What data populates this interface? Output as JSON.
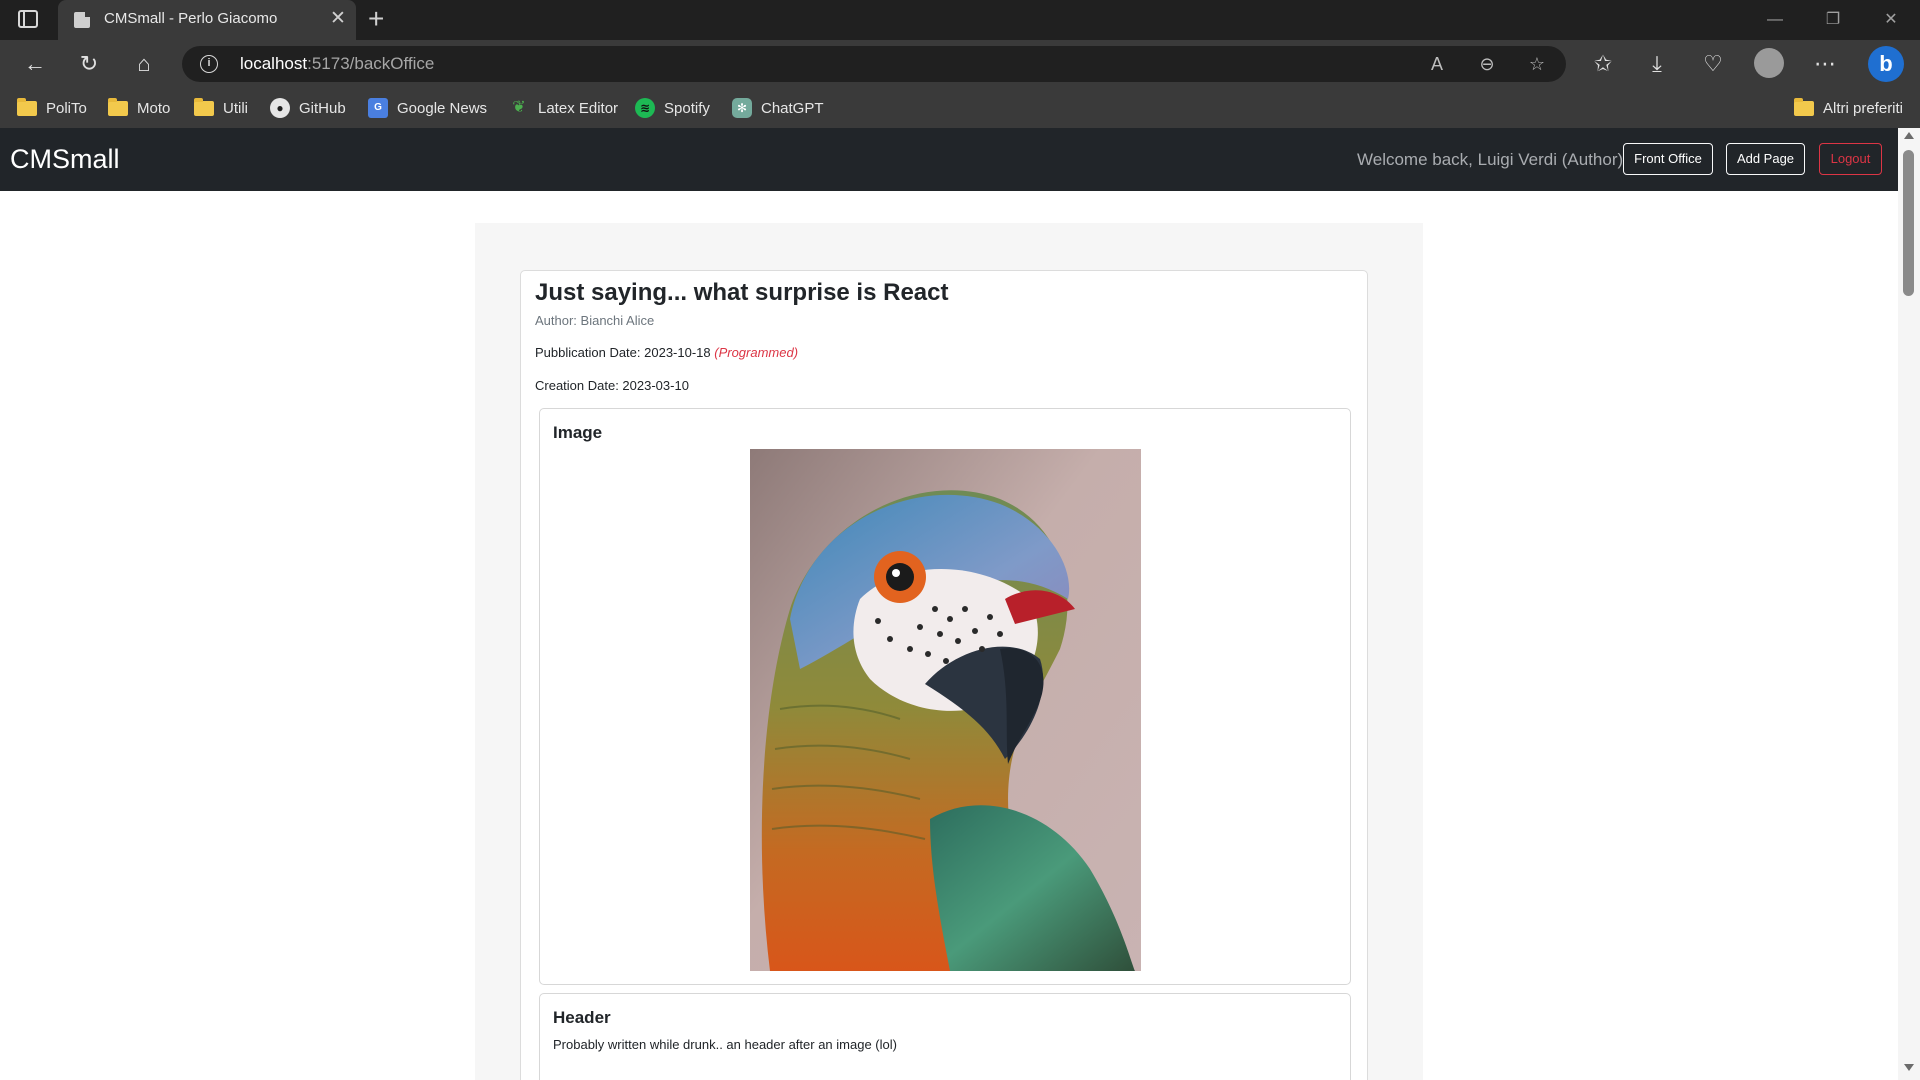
{
  "browser": {
    "tab_title": "CMSmall - Perlo Giacomo",
    "url_host": "localhost",
    "url_rest": ":5173/backOffice",
    "bookmarks": [
      {
        "label": "PoliTo",
        "icon": "folder-icon"
      },
      {
        "label": "Moto",
        "icon": "folder-icon"
      },
      {
        "label": "Utili",
        "icon": "folder-icon"
      },
      {
        "label": "GitHub",
        "icon": "github-icon"
      },
      {
        "label": "Google News",
        "icon": "google-news-icon"
      },
      {
        "label": "Latex Editor",
        "icon": "latex-icon"
      },
      {
        "label": "Spotify",
        "icon": "spotify-icon"
      },
      {
        "label": "ChatGPT",
        "icon": "chatgpt-icon"
      }
    ],
    "other_bookmarks": "Altri preferiti"
  },
  "navbar": {
    "brand": "CMSmall",
    "welcome": "Welcome back, Luigi Verdi (Author)",
    "front_office_label": "Front Office",
    "add_page_label": "Add Page",
    "logout_label": "Logout"
  },
  "page": {
    "title": "Just saying... what surprise is React",
    "author": "Author: Bianchi Alice",
    "publication_label": "Pubblication Date: 2023-10-18",
    "publication_status": "(Programmed)",
    "creation_label": "Creation Date: 2023-03-10",
    "blocks": [
      {
        "type": "Image",
        "title": "Image",
        "image": "parrot-illustration"
      },
      {
        "type": "Header",
        "title": "Header",
        "text": "Probably written while drunk.. an header after an image (lol)"
      }
    ]
  },
  "colors": {
    "navbar_bg": "#212529",
    "danger": "#dc3545",
    "muted": "#6c757d"
  }
}
